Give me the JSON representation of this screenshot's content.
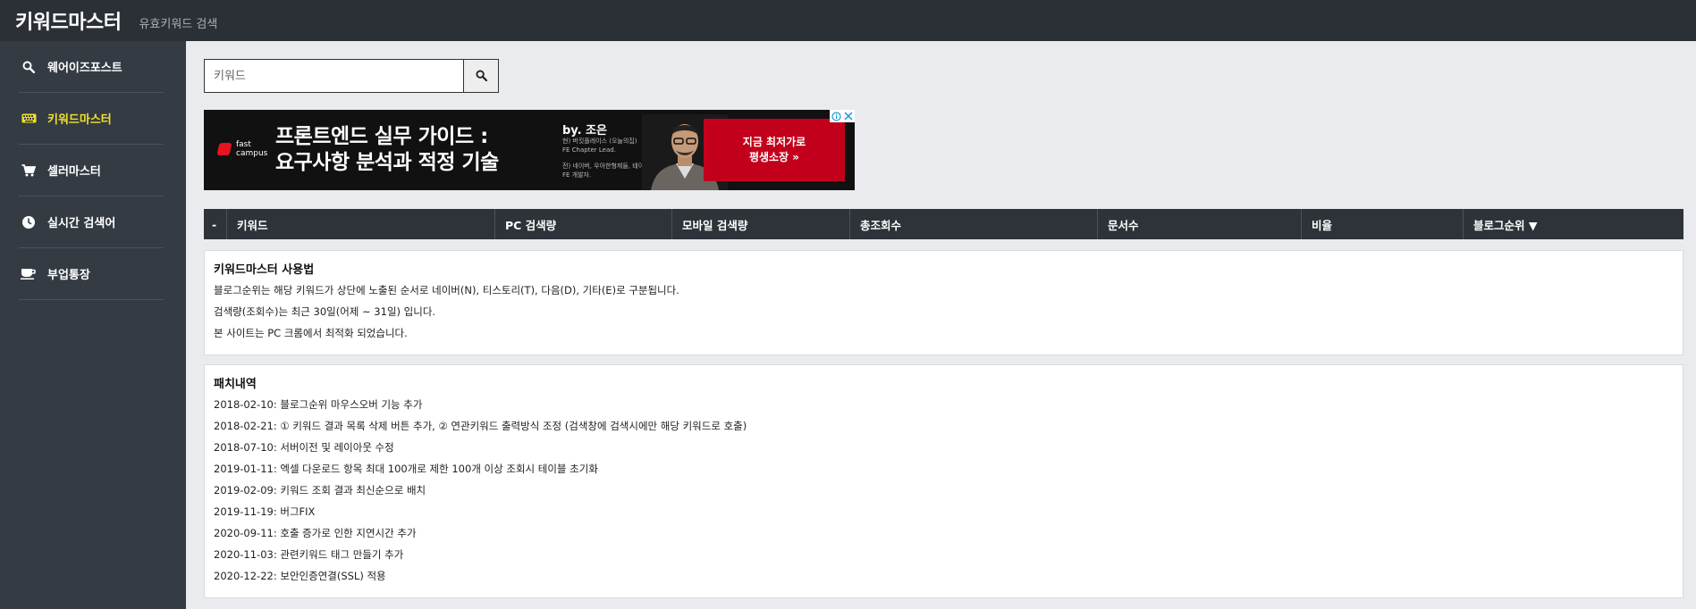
{
  "header": {
    "title": "키워드마스터",
    "subtitle": "유효키워드 검색"
  },
  "sidebar": {
    "items": [
      {
        "label": "웨어이즈포스트",
        "icon": "search-icon",
        "active": false
      },
      {
        "label": "키워드마스터",
        "icon": "keyboard-icon",
        "active": true
      },
      {
        "label": "셀러마스터",
        "icon": "cart-icon",
        "active": false
      },
      {
        "label": "실시간 검색어",
        "icon": "clock-icon",
        "active": false
      },
      {
        "label": "부업통장",
        "icon": "coffee-icon",
        "active": false
      }
    ]
  },
  "search": {
    "placeholder": "키워드",
    "value": ""
  },
  "ad": {
    "logo": "fast\ncampus",
    "headline1": "프론트엔드 실무 가이드 :",
    "headline2": "요구사항 분석과 적정 기술",
    "by": "by. 조은",
    "cv1": "현) 버킷플레이스 (오늘의집)",
    "cv2": "FE Chapter Lead.",
    "cv3": "전) 네이버, 우아한형제들, 테이블",
    "cv4": "FE 개발자.",
    "cta1": "지금 최저가로",
    "cta2": "평생소장 »"
  },
  "table": {
    "columns": [
      "-",
      "키워드",
      "PC 검색량",
      "모바일 검색량",
      "총조회수",
      "문서수",
      "비율",
      "블로그순위 ▼"
    ]
  },
  "usage": {
    "title": "키워드마스터 사용법",
    "lines": [
      "블로그순위는 해당 키워드가 상단에 노출된 순서로 네이버(N), 티스토리(T), 다음(D), 기타(E)로 구분됩니다.",
      "검색량(조회수)는 최근 30일(어제 ~ 31일) 입니다.",
      "본 사이트는 PC 크롬에서 최적화 되었습니다."
    ]
  },
  "patch": {
    "title": "패치내역",
    "lines": [
      "2018-02-10: 블로그순위 마우스오버 기능 추가",
      "2018-02-21: ① 키워드 결과 목록 삭제 버튼 추가, ② 연관키워드 출력방식 조정 (검색창에 검색시에만 해당 키워드로 호출)",
      "2018-07-10: 서버이전 및 레이아웃 수정",
      "2019-01-11: 엑셀 다운로드 항목 최대 100개로 제한 100개 이상 조회시 테이블 초기화",
      "2019-02-09: 키워드 조회 결과 최신순으로 배치",
      "2019-11-19: 버그FIX",
      "2020-09-11: 호출 증가로 인한 지연시간 추가",
      "2020-11-03: 관련키워드 태그 만들기 추가",
      "2020-12-22: 보안인증연결(SSL) 적용"
    ]
  },
  "colors": {
    "topbar": "#2b3036",
    "sidebar": "#343b43",
    "active": "#f0e02a",
    "background": "#e9ebee",
    "ad_cta": "#c3001b"
  }
}
